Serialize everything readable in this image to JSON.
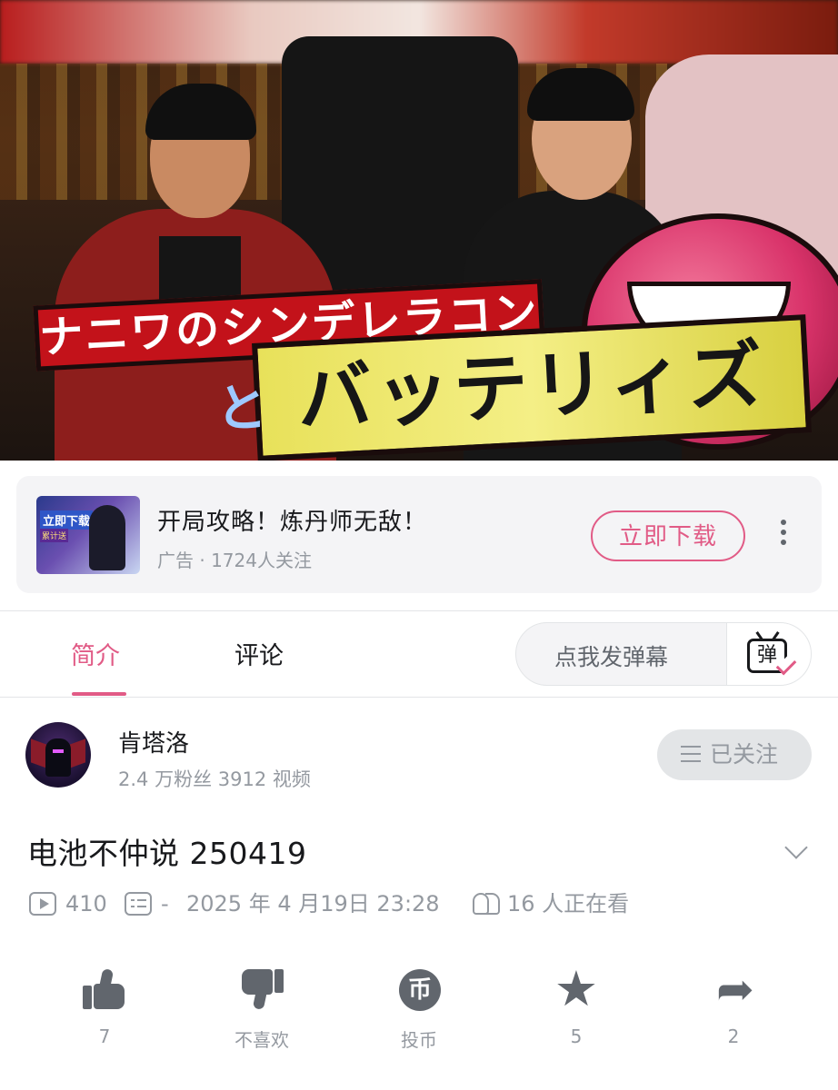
{
  "video": {
    "overlay_title_top": "ナニワのシンデレラコンビ",
    "overlay_title_connector": "と",
    "overlay_title_main": "バッテリィズ"
  },
  "ad": {
    "thumb_tag": "立即下载",
    "thumb_subtag": "累计送",
    "title": "开局攻略！炼丹师无敌！",
    "meta": "广告 · 1724人关注",
    "cta_label": "立即下载"
  },
  "tabs": [
    {
      "label": "简介",
      "active": true
    },
    {
      "label": "评论",
      "active": false
    }
  ],
  "danmaku": {
    "placeholder": "点我发弹幕",
    "toggle_glyph": "弹"
  },
  "uploader": {
    "name": "肯塔洛",
    "stats": "2.4 万粉丝   3912 视频",
    "follow_label": "已关注"
  },
  "video_info": {
    "title": "电池不仲说 250419",
    "play_count": "410",
    "danmaku_count": "-",
    "publish_time": "2025 年 4 月19日 23:28",
    "watching_now": "16 人正在看"
  },
  "actions": [
    {
      "icon": "thumbs-up-icon",
      "label": "7"
    },
    {
      "icon": "thumbs-down-icon",
      "label": "不喜欢"
    },
    {
      "icon": "coin-icon",
      "label": "投币",
      "glyph": "币"
    },
    {
      "icon": "star-icon",
      "label": "5"
    },
    {
      "icon": "share-icon",
      "label": "2"
    }
  ],
  "colors": {
    "accent": "#e15b86",
    "text_primary": "#18191c",
    "text_secondary": "#9499a0",
    "icon_gray": "#61666d",
    "card_bg": "#f4f4f6"
  }
}
